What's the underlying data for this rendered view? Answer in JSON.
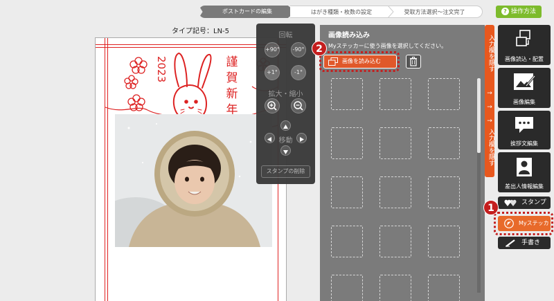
{
  "steps": [
    {
      "label": "ポストカードの編集",
      "active": true
    },
    {
      "label": "はがき種類・枚数の設定",
      "active": false
    },
    {
      "label": "受取方法選択〜注文完了",
      "active": false
    }
  ],
  "help": {
    "icon": "?",
    "label": "操作方法"
  },
  "postcard": {
    "type_code": "タイプ記号：LN-5",
    "year": "2023",
    "greeting": "謹賀新年"
  },
  "palette": {
    "rotate_title": "回転",
    "rotate_buttons": [
      "+90°",
      "-90°",
      "+1°",
      "-1°"
    ],
    "zoom_title": "拡大・縮小",
    "move_title": "移動",
    "delete_stamp": "スタンプの削除"
  },
  "image_panel": {
    "title": "画像読み込み",
    "subtitle": "Myステッカーに使う画像を選択してください。",
    "load_button": "画像を読み込む"
  },
  "side_tab": {
    "upper": "入力欄を隠す",
    "lower": "入力欄を隠す",
    "arrows": [
      "→",
      "→",
      "→"
    ]
  },
  "tools": {
    "image_load_layout": "画像読込・配置",
    "image_edit": "画像編集",
    "greeting_edit": "挨拶文編集",
    "sender_edit": "差出人情報編集",
    "stamp": "スタンプ",
    "my_sticker": "Myステッカー",
    "handwriting": "手書き"
  },
  "callouts": {
    "one": "1",
    "two": "2"
  },
  "colors": {
    "accent_orange": "#e8581e",
    "callout_red": "#c41e1e",
    "help_green": "#7dbb2c",
    "card_red": "#d22222"
  }
}
